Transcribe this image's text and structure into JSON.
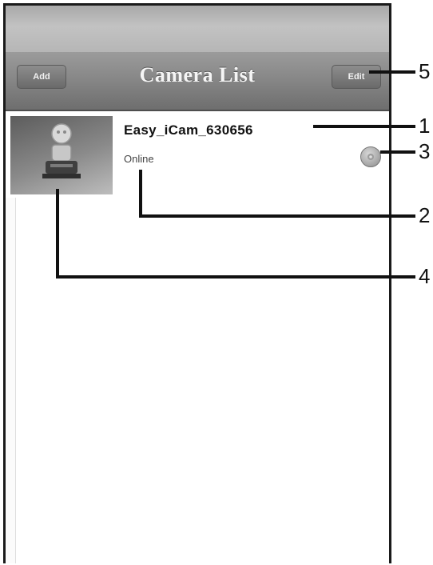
{
  "navbar": {
    "add_label": "Add",
    "title": "Camera List",
    "edit_label": "Edit"
  },
  "camera_list": [
    {
      "name": "Easy_iCam_630656",
      "status": "Online"
    }
  ],
  "callouts": {
    "n1": "1",
    "n2": "2",
    "n3": "3",
    "n4": "4",
    "n5": "5"
  }
}
